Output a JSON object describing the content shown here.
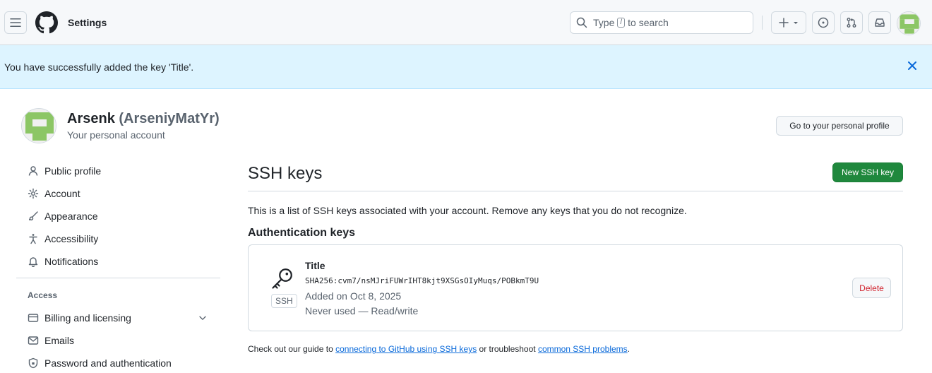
{
  "header": {
    "context_title": "Settings",
    "search": {
      "prefix": "Type",
      "key": "/",
      "suffix": "to search"
    }
  },
  "flash": {
    "message": "You have successfully added the key 'Title'."
  },
  "profile": {
    "name": "Arsenk",
    "login": "(ArseniyMatYr)",
    "subtitle": "Your personal account",
    "profile_button": "Go to your personal profile"
  },
  "sidebar": {
    "items": [
      {
        "label": "Public profile",
        "icon": "person-icon"
      },
      {
        "label": "Account",
        "icon": "gear-icon"
      },
      {
        "label": "Appearance",
        "icon": "paintbrush-icon"
      },
      {
        "label": "Accessibility",
        "icon": "accessibility-icon"
      },
      {
        "label": "Notifications",
        "icon": "bell-icon"
      }
    ],
    "access_heading": "Access",
    "access_items": [
      {
        "label": "Billing and licensing",
        "icon": "credit-card-icon"
      },
      {
        "label": "Emails",
        "icon": "mail-icon"
      },
      {
        "label": "Password and authentication",
        "icon": "shield-lock-icon"
      }
    ]
  },
  "main": {
    "title": "SSH keys",
    "new_button": "New SSH key",
    "description": "This is a list of SSH keys associated with your account. Remove any keys that you do not recognize.",
    "auth_heading": "Authentication keys",
    "key": {
      "badge": "SSH",
      "title": "Title",
      "fingerprint": "SHA256:cvm7/nsMJriFUWrIHT8kjt9XSGsOIyMuqs/POBkmT9U",
      "added": "Added on Oct 8, 2025",
      "usage": "Never used — Read/write",
      "delete_button": "Delete"
    },
    "footer": {
      "before": "Check out our guide to",
      "link1": "connecting to GitHub using SSH keys",
      "middle": "or troubleshoot",
      "link2": "common SSH problems",
      "after": "."
    }
  },
  "colors": {
    "accent_blue": "#0969da",
    "flash_bg": "#ddf4ff",
    "primary_green": "#1f883d",
    "danger_red": "#d1242f",
    "identicon_green": "#8cc665"
  }
}
